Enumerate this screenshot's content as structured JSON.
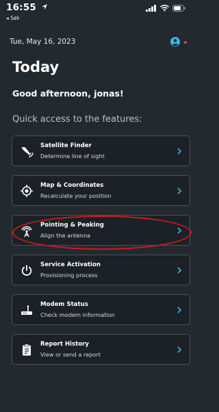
{
  "status_bar": {
    "time": "16:55",
    "back_app": "◂ Søk"
  },
  "header": {
    "date": "Tue, May 16, 2023"
  },
  "page": {
    "title": "Today",
    "greeting": "Good afternoon, jonas!",
    "section_label": "Quick access to the features:"
  },
  "features": [
    {
      "title": "Satellite Finder",
      "subtitle": "Determine line of sight",
      "icon": "satellite-icon"
    },
    {
      "title": "Map & Coordinates",
      "subtitle": "Recalculate your position",
      "icon": "location-target-icon"
    },
    {
      "title": "Pointing & Peaking",
      "subtitle": "Align the antenna",
      "icon": "antenna-icon"
    },
    {
      "title": "Service Activation",
      "subtitle": "Provisioning process",
      "icon": "power-icon"
    },
    {
      "title": "Modem Status",
      "subtitle": "Check modem information",
      "icon": "modem-icon"
    },
    {
      "title": "Report History",
      "subtitle": "View or send a report",
      "icon": "clipboard-icon"
    }
  ],
  "colors": {
    "background": "#22292f",
    "card_background": "#1b2126",
    "card_border": "#4b545c",
    "accent": "#3fb3e6",
    "highlight_ring": "#d7161f",
    "notification_dot": "#e0424b"
  }
}
